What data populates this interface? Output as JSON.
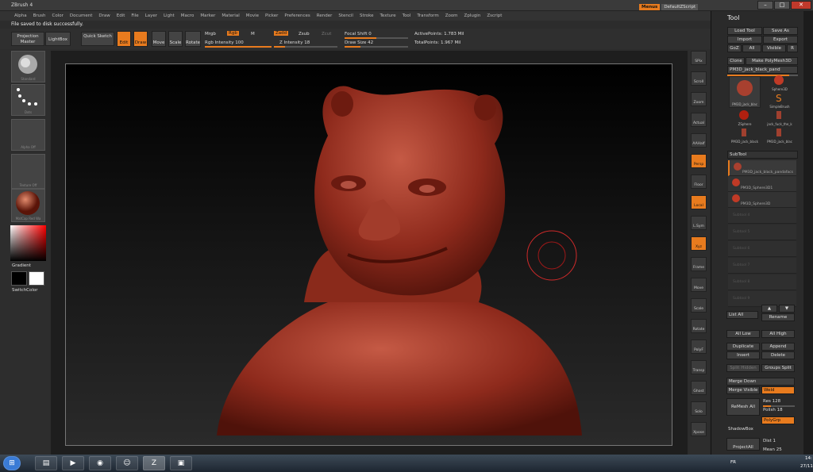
{
  "app": {
    "title": "ZBrush 4"
  },
  "menu": [
    "Alpha",
    "Brush",
    "Color",
    "Document",
    "Draw",
    "Edit",
    "File",
    "Layer",
    "Light",
    "Macro",
    "Marker",
    "Material",
    "Movie",
    "Picker",
    "Preferences",
    "Render",
    "Stencil",
    "Stroke",
    "Texture",
    "Tool",
    "Transform",
    "Zoom",
    "Zplugin",
    "Zscript"
  ],
  "topright": {
    "menus": "Menus",
    "script": "DefaultZScript"
  },
  "status": "File saved to disk successfully.",
  "toolbar": {
    "projection_master": "Projection Master",
    "lightbox": "LightBox",
    "quick_sketch": "Quick Sketch",
    "edit": "Edit",
    "draw": "Draw",
    "move": "Move",
    "scale": "Scale",
    "rotate": "Rotate",
    "mrgb": "Mrgb",
    "rgb": "Rgb",
    "m": "M",
    "zadd": "Zadd",
    "zsub": "Zsub",
    "zcut": "Zcut",
    "rgb_intensity": "Rgb Intensity 100",
    "z_intensity": "Z Intensity 18",
    "focal_shift": "Focal Shift 0",
    "draw_size": "Draw Size 42",
    "active_points": "ActivePoints: 1.783 Mil",
    "total_points": "TotalPoints: 1.967 Mil"
  },
  "leftpanel": {
    "brush": "Standard",
    "stroke": "Dots",
    "alpha": "Alpha Off",
    "texture": "Texture Off",
    "material": "MatCap Red Wa",
    "gradient": "Gradient",
    "switchcolor": "SwitchColor"
  },
  "rightstrip": [
    "SPix",
    "Scroll",
    "Zoom",
    "Actual",
    "AAHalf",
    "Persp",
    "Floor",
    "Local",
    "L.Sym",
    "Xyz",
    "Frame",
    "Move",
    "Scale",
    "Rotate",
    "PolyF",
    "Transp",
    "Ghost",
    "Solo",
    "Xpose"
  ],
  "toolpanel": {
    "title": "Tool",
    "load_tool": "Load Tool",
    "save_as": "Save As",
    "import": "Import",
    "export": "Export",
    "goz": "GoZ",
    "all": "All",
    "visible": "Visible",
    "r": "R",
    "clone": "Clone",
    "make_polymesh": "Make PolyMesh3D",
    "current_tool": "PM3D_jack_black_pand",
    "thumbs": [
      "PM3D_jack_blac",
      "Sphere3D",
      "SimpleBrush",
      "ZSphere",
      "jack_fuck_the_k",
      "PM3D_jack_black",
      "PM3D_jack_blac"
    ],
    "subtool": "SubTool",
    "subtools": [
      "PM3D_jack_black_pandafacs",
      "PM3D_Sphere3D1",
      "PM3D_Sphere3D"
    ],
    "empties": [
      "Subtool 4",
      "Subtool 5",
      "Subtool 6",
      "Subtool 7",
      "Subtool 8",
      "Subtool 9"
    ],
    "list_all": "List All",
    "rename": "Rename",
    "all_low": "All Low",
    "all_high": "All High",
    "duplicate": "Duplicate",
    "append": "Append",
    "insert": "Insert",
    "delete": "Delete",
    "split_hidden": "Split Hidden",
    "groups_split": "Groups Split",
    "merge_down": "Merge Down",
    "merge_visible": "Merge Visible",
    "weld": "Weld",
    "remesh_all": "ReMesh All",
    "res": "Res 128",
    "polish": "Polish 18",
    "polygrp": "PolyGrp",
    "shadowbox": "ShadowBox",
    "project_all": "ProjectAll",
    "dist": "Dist 1",
    "mean": "Mean 25"
  },
  "taskbar": {
    "lang": "FR",
    "time": "14:",
    "date": "27/11"
  }
}
